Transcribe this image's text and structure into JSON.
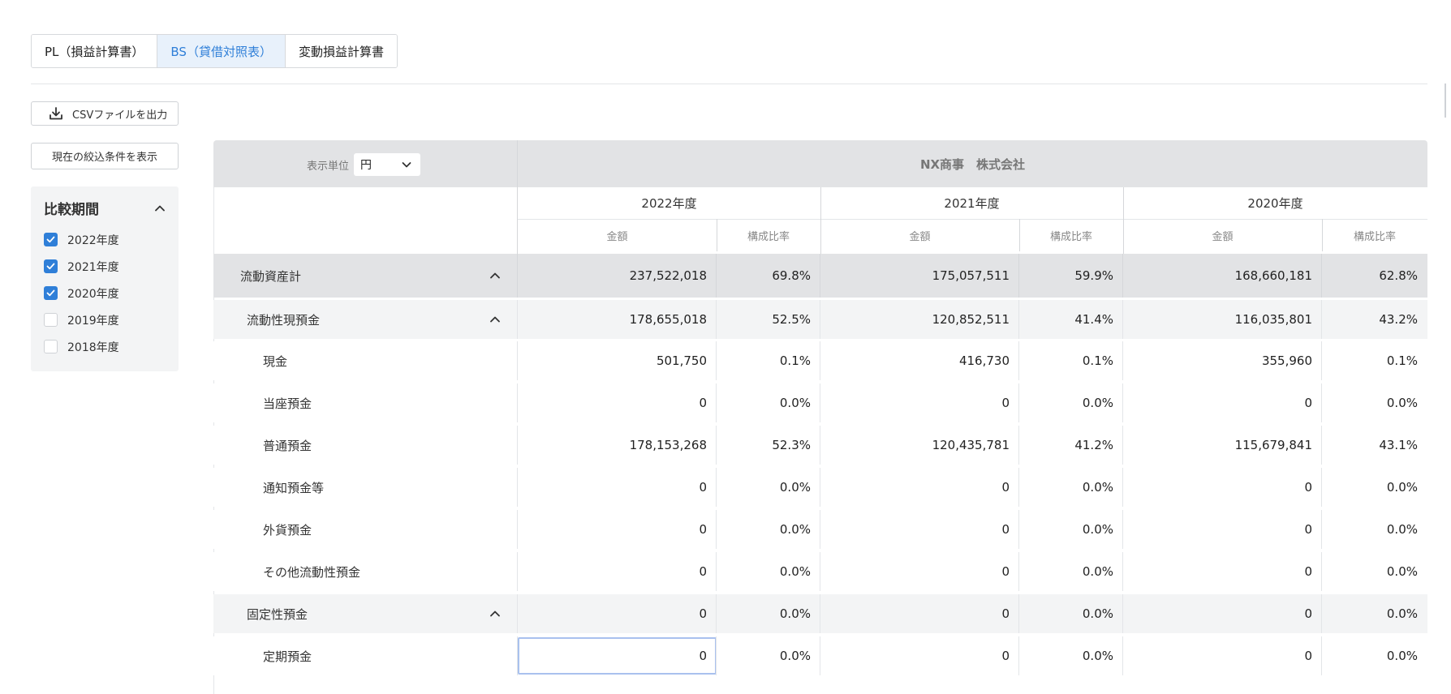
{
  "tabs": [
    {
      "label": "PL（損益計算書）",
      "active": false
    },
    {
      "label": "BS（貸借対照表）",
      "active": true
    },
    {
      "label": "変動損益計算書",
      "active": false
    }
  ],
  "toolbar": {
    "csv_label": "CSVファイルを出力",
    "filter_label": "現在の絞込条件を表示"
  },
  "period_panel": {
    "title": "比較期間",
    "options": [
      {
        "label": "2022年度",
        "checked": true
      },
      {
        "label": "2021年度",
        "checked": true
      },
      {
        "label": "2020年度",
        "checked": true
      },
      {
        "label": "2019年度",
        "checked": false
      },
      {
        "label": "2018年度",
        "checked": false
      }
    ]
  },
  "table": {
    "unit_label": "表示単位",
    "unit_value": "円",
    "company": "NX商事　株式会社",
    "years": [
      "2022年度",
      "2021年度",
      "2020年度"
    ],
    "col_amount": "金額",
    "col_ratio": "構成比率",
    "rows": [
      {
        "label": "流動資産計",
        "level": 1,
        "values": [
          "237,522,018",
          "69.8%",
          "175,057,511",
          "59.9%",
          "168,660,181",
          "62.8%"
        ]
      },
      {
        "label": "流動性現預金",
        "level": 2,
        "values": [
          "178,655,018",
          "52.5%",
          "120,852,511",
          "41.4%",
          "116,035,801",
          "43.2%"
        ]
      },
      {
        "label": "現金",
        "level": 3,
        "values": [
          "501,750",
          "0.1%",
          "416,730",
          "0.1%",
          "355,960",
          "0.1%"
        ]
      },
      {
        "label": "当座預金",
        "level": 3,
        "values": [
          "0",
          "0.0%",
          "0",
          "0.0%",
          "0",
          "0.0%"
        ]
      },
      {
        "label": "普通預金",
        "level": 3,
        "values": [
          "178,153,268",
          "52.3%",
          "120,435,781",
          "41.2%",
          "115,679,841",
          "43.1%"
        ]
      },
      {
        "label": "通知預金等",
        "level": 3,
        "values": [
          "0",
          "0.0%",
          "0",
          "0.0%",
          "0",
          "0.0%"
        ]
      },
      {
        "label": "外貨預金",
        "level": 3,
        "values": [
          "0",
          "0.0%",
          "0",
          "0.0%",
          "0",
          "0.0%"
        ]
      },
      {
        "label": "その他流動性預金",
        "level": 3,
        "values": [
          "0",
          "0.0%",
          "0",
          "0.0%",
          "0",
          "0.0%"
        ]
      },
      {
        "label": "固定性預金",
        "level": 2,
        "values": [
          "0",
          "0.0%",
          "0",
          "0.0%",
          "0",
          "0.0%"
        ]
      },
      {
        "label": "定期預金",
        "level": 3,
        "values": [
          "0",
          "0.0%",
          "0",
          "0.0%",
          "0",
          "0.0%"
        ]
      }
    ]
  }
}
